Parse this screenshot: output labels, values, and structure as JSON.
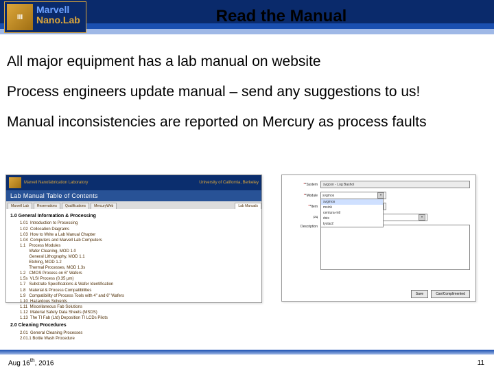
{
  "header": {
    "logo_top": "Marvell",
    "logo_bottom": "Nano.Lab",
    "title": "Read the Manual"
  },
  "body": {
    "p1": "All major equipment has a lab manual on website",
    "p2": "Process engineers update manual – send any suggestions to us!",
    "p3": "Manual inconsistencies are reported on Mercury as process faults"
  },
  "thumb_a": {
    "brand_left": "Marvell Nanofabrication Laboratory",
    "brand_right": "University of California, Berkeley",
    "title": "Lab Manual Table of Contents",
    "tabs": [
      "Marvell Lab",
      "Reservations",
      "Qualifications",
      "MercuryWeb"
    ],
    "active_tab": "Lab Manuals",
    "section1": "1.0  General Information & Processing",
    "items1": [
      "1.01  Introduction to Processing",
      "1.02  Collocation Diagrams",
      "1.03  How to Write a Lab Manual Chapter",
      "1.04  Computers and Marvell Lab Computers",
      "1.1   Process Modules",
      "        Wafer Cleaning, MOD 1.0",
      "        General Lithography, MOD 1.1",
      "        Etching, MOD 1.2",
      "        Thermal Processes, MOD 1.3s",
      "1.2   CMOS Process on 6\" Wafers",
      "1.5s  VLSI Process (0.35 μm)",
      "1.7   Substrate Specifications & Wafer Identification",
      "1.8   Material & Process Compatibilities",
      "1.9   Compatibility of Process Tools with 4\" and 6\" Wafers",
      "1.10  Hazardous Solvents",
      "1.11  Miscellaneous Fab Solutions",
      "1.12  Material Safety Data Sheets (MSDS)",
      "1.13  The TI Fab (Ltd) Deposition TI LCDs Pilots"
    ],
    "section2": "2.0  Cleaning Procedures",
    "items2": [
      "2.01  General Cleaning Processes",
      "2.01.1 Bottle Wash Procedure"
    ]
  },
  "thumb_b": {
    "labels": {
      "system": "*System",
      "module": "*Module",
      "item": "*Item",
      "p4": "P4",
      "descr": "Description"
    },
    "system_value": "svgcon - Log Bashol",
    "dd_module": [
      "svgmos",
      "msink",
      "centura-mtl",
      "dsis",
      "tystar2"
    ],
    "btn_save": "Save",
    "btn_cancel": "Can/Complimented"
  },
  "footer": {
    "date_a": "Aug 16",
    "date_b": "th",
    "date_c": ", 2016",
    "page": "11"
  }
}
